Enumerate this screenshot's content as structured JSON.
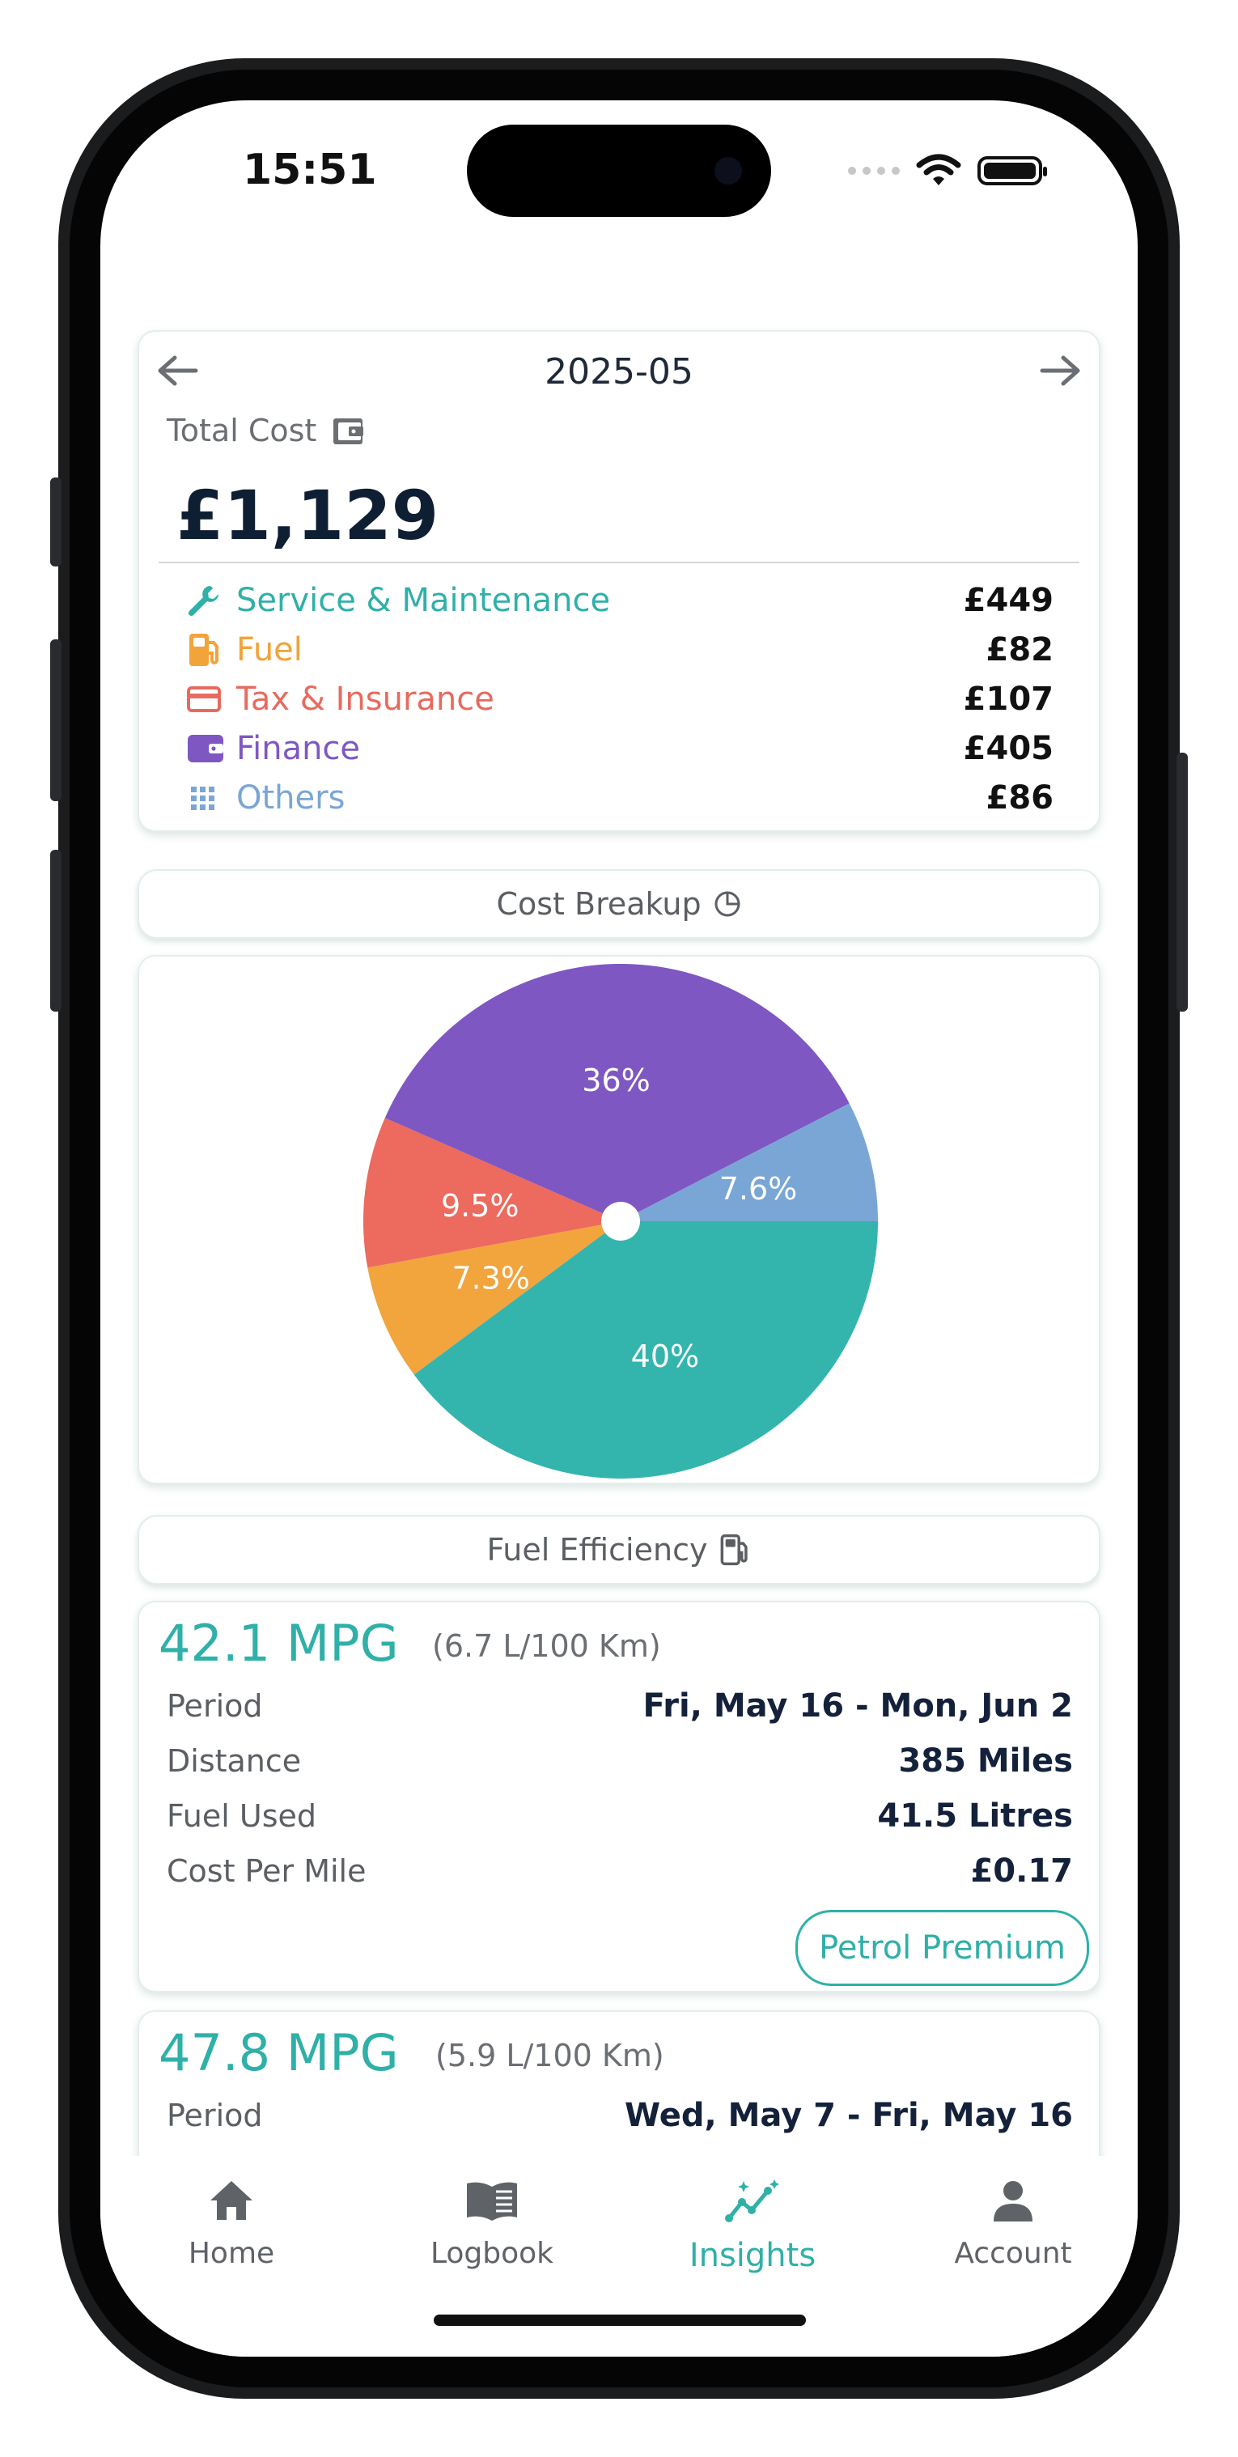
{
  "status_bar": {
    "time": "15:51"
  },
  "summary": {
    "month": "2025-05",
    "total_label": "Total Cost",
    "total_value": "£1,129",
    "categories": [
      {
        "name": "Service & Maintenance",
        "amount": "£449",
        "color": "#2fb0a8",
        "icon": "wrench-icon"
      },
      {
        "name": "Fuel",
        "amount": "£82",
        "color": "#f2a33a",
        "icon": "fuel-pump-icon"
      },
      {
        "name": "Tax & Insurance",
        "amount": "£107",
        "color": "#e86a5e",
        "icon": "credit-card-icon"
      },
      {
        "name": "Finance",
        "amount": "£405",
        "color": "#7e57c2",
        "icon": "wallet-icon"
      },
      {
        "name": "Others",
        "amount": "£86",
        "color": "#7aa6d6",
        "icon": "grid-icon"
      }
    ]
  },
  "cost_breakup": {
    "header": "Cost Breakup",
    "icon": "pie-chart-icon"
  },
  "chart_data": {
    "type": "pie",
    "slices": [
      {
        "category": "Service & Maintenance",
        "percent": 40,
        "label": "40%",
        "color": "#33b5ae"
      },
      {
        "category": "Fuel",
        "percent": 7.3,
        "label": "7.3%",
        "color": "#f2a43d"
      },
      {
        "category": "Tax & Insurance",
        "percent": 9.5,
        "label": "9.5%",
        "color": "#ec6a5e"
      },
      {
        "category": "Finance",
        "percent": 36,
        "label": "36%",
        "color": "#7e57c2"
      },
      {
        "category": "Others",
        "percent": 7.6,
        "label": "7.6%",
        "color": "#7aa6d6"
      }
    ]
  },
  "fuel_efficiency": {
    "header": "Fuel Efficiency",
    "icon": "fuel-pump-icon",
    "entries": [
      {
        "mpg": "42.1 MPG",
        "metric": "(6.7 L/100 Km)",
        "rows": [
          {
            "key": "Period",
            "value": "Fri, May 16 - Mon, Jun 2"
          },
          {
            "key": "Distance",
            "value": "385 Miles"
          },
          {
            "key": "Fuel Used",
            "value": "41.5 Litres"
          },
          {
            "key": "Cost Per Mile",
            "value": "£0.17"
          }
        ],
        "fuel_type": "Petrol Premium"
      },
      {
        "mpg": "47.8 MPG",
        "metric": "(5.9 L/100 Km)",
        "rows": [
          {
            "key": "Period",
            "value": "Wed, May 7 - Fri, May 16"
          }
        ]
      }
    ]
  },
  "tabs": [
    {
      "label": "Home",
      "icon": "home-icon",
      "active": false
    },
    {
      "label": "Logbook",
      "icon": "book-icon",
      "active": false
    },
    {
      "label": "Insights",
      "icon": "insights-icon",
      "active": true
    },
    {
      "label": "Account",
      "icon": "person-icon",
      "active": false
    }
  ],
  "colors": {
    "accent": "#2fb0a8",
    "text_dark": "#14213a"
  }
}
